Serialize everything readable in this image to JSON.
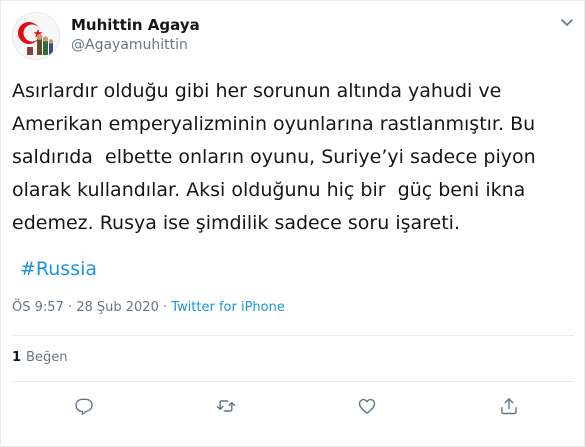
{
  "author": {
    "display_name": "Muhittin Agaya",
    "handle": "@Agayamuhittin",
    "avatar_icon": "avatar-flag-icon"
  },
  "tweet": {
    "text": "Asırlardır olduğu gibi her sorunun altında yahudi ve\nAmerikan emperyalizminin oyunlarına rastlanmıştır. Bu\nsaldırıda  elbette onların oyunu, Suriye’yi sadece piyon\nolarak kullandılar. Aksi olduğunu hiç bir  güç beni ikna\nedemez. Rusya ise şimdilik sadece soru işareti.",
    "hashtag": "#Russia",
    "timestamp": "ÖS 9:57 · 28 Şub 2020 · ",
    "source": "Twitter for iPhone"
  },
  "stats": {
    "like_count": "1",
    "like_label": "Beğen"
  },
  "actions": {
    "reply_icon": "reply-icon",
    "retweet_icon": "retweet-icon",
    "like_icon": "heart-icon",
    "share_icon": "share-icon"
  },
  "colors": {
    "link": "#1b95e0",
    "muted": "#657786",
    "text": "#14171a",
    "flag_red": "#e30a17"
  }
}
